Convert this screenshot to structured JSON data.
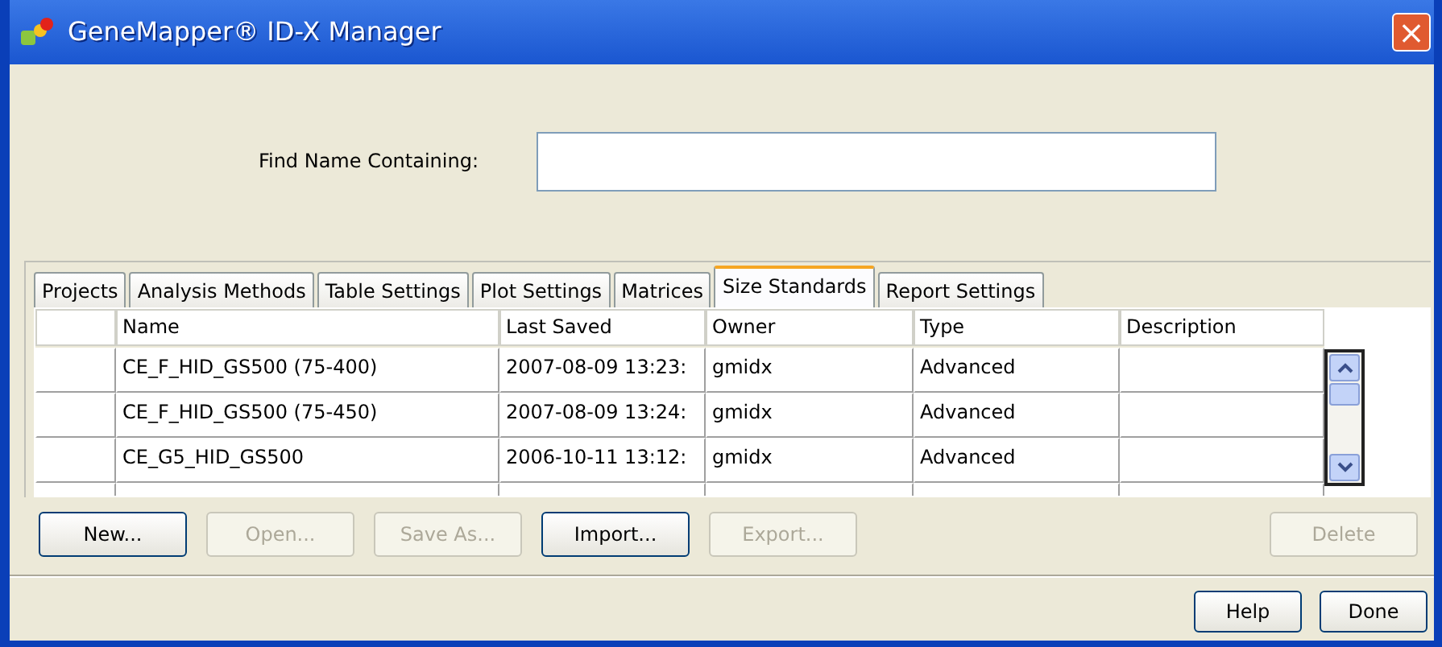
{
  "window": {
    "title": "GeneMapper® ID-X Manager",
    "close": "×"
  },
  "search": {
    "label": "Find Name Containing:"
  },
  "tabs": [
    {
      "label": "Projects",
      "selected": false
    },
    {
      "label": "Analysis Methods",
      "selected": false
    },
    {
      "label": "Table Settings",
      "selected": false
    },
    {
      "label": "Plot Settings",
      "selected": false
    },
    {
      "label": "Matrices",
      "selected": false
    },
    {
      "label": "Size Standards",
      "selected": true
    },
    {
      "label": "Report Settings",
      "selected": false
    }
  ],
  "table": {
    "columns": [
      "Name",
      "Last Saved",
      "Owner",
      "Type",
      "Description"
    ],
    "rows": [
      [
        "CE_F_HID_GS500 (75-400)",
        "2007-08-09 13:23:",
        "gmidx",
        "Advanced",
        ""
      ],
      [
        "CE_F_HID_GS500 (75-450)",
        "2007-08-09 13:24:",
        "gmidx",
        "Advanced",
        ""
      ],
      [
        "CE_G5_HID_GS500",
        "2006-10-11 13:12:",
        "gmidx",
        "Advanced",
        ""
      ]
    ]
  },
  "actions": [
    {
      "label": "New...",
      "disabled": false
    },
    {
      "label": "Open...",
      "disabled": true
    },
    {
      "label": "Save As...",
      "disabled": true
    },
    {
      "label": "Import...",
      "disabled": false
    },
    {
      "label": "Export...",
      "disabled": true
    },
    {
      "label": "Delete",
      "disabled": true
    }
  ],
  "footer_buttons": [
    "Help",
    "Done"
  ]
}
